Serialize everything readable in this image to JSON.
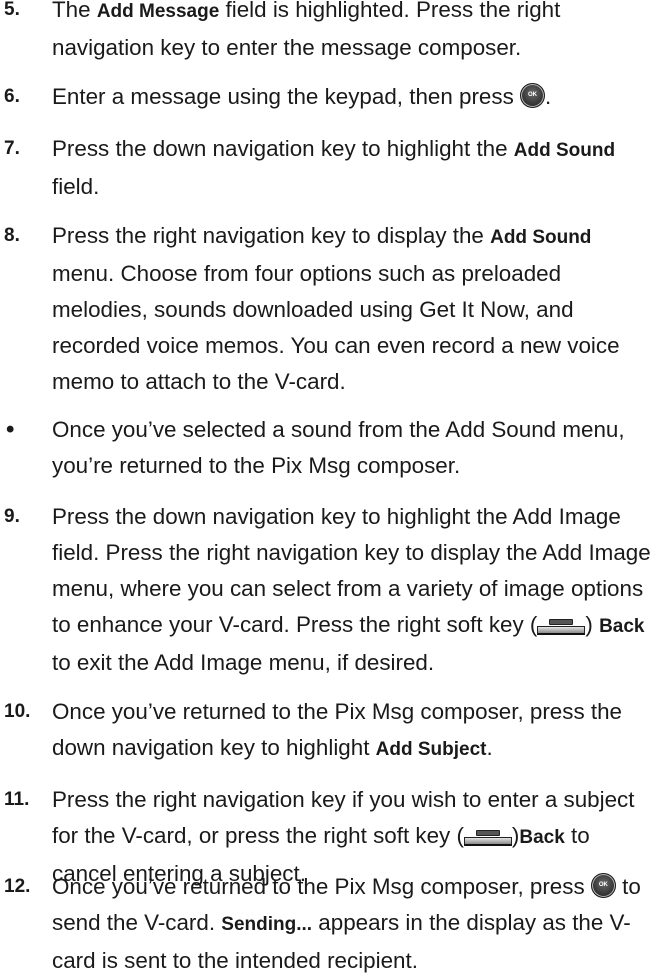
{
  "steps": [
    {
      "num": "5.",
      "parts": [
        "The ",
        "Add Message",
        " field is highlighted. Press the right navigation key to enter the message composer."
      ]
    },
    {
      "num": "6.",
      "parts": [
        "Enter a message using the keypad, then press ",
        "."
      ]
    },
    {
      "num": "7.",
      "parts": [
        "Press the down navigation key to highlight the ",
        "Add Sound",
        " field."
      ]
    },
    {
      "num": "8.",
      "parts": [
        "Press the right navigation key to display the ",
        "Add Sound",
        " menu. Choose from four options such as preloaded melodies, sounds downloaded using Get It Now, and recorded voice memos. You can even record a new voice memo to attach to the V-card."
      ]
    },
    {
      "num": "•",
      "parts": [
        "Once you’ve selected a sound from the Add Sound menu, you’re returned to the Pix Msg composer."
      ]
    },
    {
      "num": "9.",
      "parts": [
        "Press the down navigation key to highlight the Add Image field. Press the right navigation key to display the Add Image menu, where you can select from a variety of image options to enhance your V-card. Press the right soft key (",
        ") ",
        "Back",
        " to exit the Add Image menu, if desired."
      ]
    },
    {
      "num": "10.",
      "parts": [
        "Once you’ve returned to the Pix Msg composer, press the down navigation key to highlight ",
        "Add Subject",
        "."
      ]
    },
    {
      "num": "11.",
      "parts": [
        "Press the right navigation key if you wish to enter a subject for the V-card, or press the right soft key (",
        ")",
        "Back",
        " to cancel entering a subject."
      ]
    },
    {
      "num": "12.",
      "parts": [
        "Once you’ve returned to the Pix Msg composer, press ",
        " to send the V-card. ",
        "Sending...",
        " appears in the display as the V-card is sent to the intended recipient."
      ]
    }
  ],
  "icons": {
    "ok_button": "ok-key-icon",
    "soft_key": "right-soft-key-icon"
  }
}
